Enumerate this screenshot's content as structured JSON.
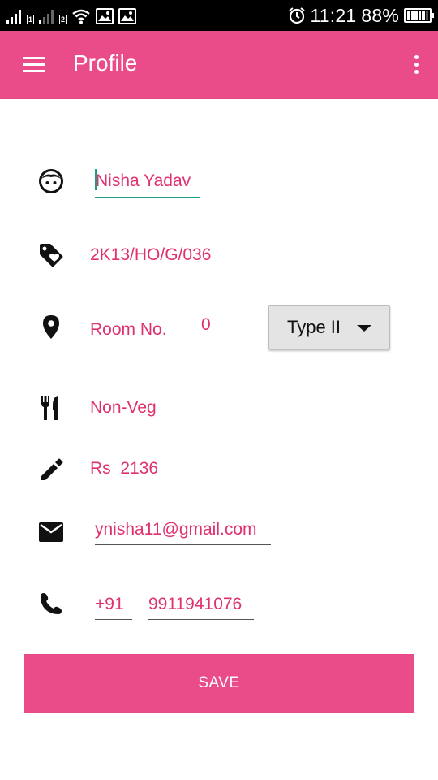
{
  "status_bar": {
    "time": "11:21",
    "battery_percent": "88%",
    "battery_level": 0.88,
    "sim1_label": "1",
    "sim2_label": "2",
    "icons": [
      "signal-icon",
      "signal-icon",
      "wifi-icon",
      "image-icon",
      "image-icon",
      "alarm-icon",
      "battery-icon"
    ]
  },
  "app_bar": {
    "title": "Profile",
    "menu_icon": "hamburger-menu-icon",
    "overflow_icon": "more-vert-icon",
    "color": "#ea4c89"
  },
  "profile": {
    "name": "Nisha Yadav",
    "id_code": "2K13/HO/G/036",
    "room_label": "Room No.",
    "room_number": "0",
    "room_type": "Type II",
    "food_pref": "Non-Veg",
    "amount_prefix": "Rs",
    "amount": "2136",
    "email": "ynisha11@gmail.com",
    "country_code": "+91",
    "phone": "9911941076"
  },
  "icons": {
    "name": "face-icon",
    "id": "tag-icon",
    "room": "location-pin-icon",
    "food": "restaurant-icon",
    "amount": "pencil-icon",
    "email": "mail-icon",
    "phone": "phone-icon"
  },
  "actions": {
    "save_label": "SAVE"
  },
  "colors": {
    "accent_pink": "#ea4c89",
    "text_pink": "#e0306f",
    "focus_teal": "#1e9e86"
  }
}
